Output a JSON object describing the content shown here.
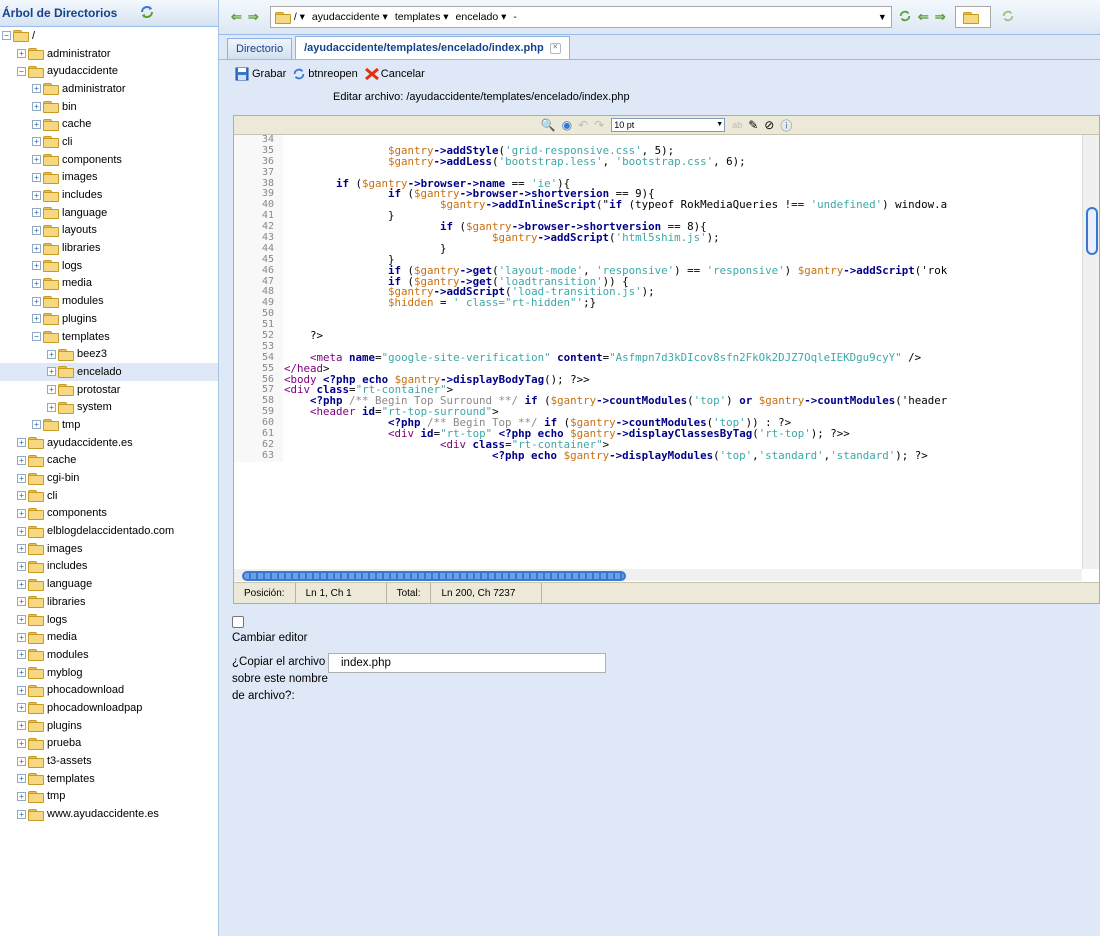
{
  "sidebar": {
    "title": "Árbol de Directorios",
    "tree": [
      {
        "label": "/",
        "level": 0,
        "expanded": true
      },
      {
        "label": "administrator",
        "level": 1,
        "expanded": false
      },
      {
        "label": "ayudaccidente",
        "level": 1,
        "expanded": true
      },
      {
        "label": "administrator",
        "level": 2,
        "expanded": false
      },
      {
        "label": "bin",
        "level": 2,
        "expanded": false
      },
      {
        "label": "cache",
        "level": 2,
        "expanded": false
      },
      {
        "label": "cli",
        "level": 2,
        "expanded": false
      },
      {
        "label": "components",
        "level": 2,
        "expanded": false
      },
      {
        "label": "images",
        "level": 2,
        "expanded": false
      },
      {
        "label": "includes",
        "level": 2,
        "expanded": false
      },
      {
        "label": "language",
        "level": 2,
        "expanded": false
      },
      {
        "label": "layouts",
        "level": 2,
        "expanded": false
      },
      {
        "label": "libraries",
        "level": 2,
        "expanded": false
      },
      {
        "label": "logs",
        "level": 2,
        "expanded": false
      },
      {
        "label": "media",
        "level": 2,
        "expanded": false
      },
      {
        "label": "modules",
        "level": 2,
        "expanded": false
      },
      {
        "label": "plugins",
        "level": 2,
        "expanded": false
      },
      {
        "label": "templates",
        "level": 2,
        "expanded": true
      },
      {
        "label": "beez3",
        "level": 3,
        "expanded": false
      },
      {
        "label": "encelado",
        "level": 3,
        "expanded": false,
        "selected": true
      },
      {
        "label": "protostar",
        "level": 3,
        "expanded": false
      },
      {
        "label": "system",
        "level": 3,
        "expanded": false
      },
      {
        "label": "tmp",
        "level": 2,
        "expanded": false
      },
      {
        "label": "ayudaccidente.es",
        "level": 1,
        "expanded": false
      },
      {
        "label": "cache",
        "level": 1,
        "expanded": false
      },
      {
        "label": "cgi-bin",
        "level": 1,
        "expanded": false
      },
      {
        "label": "cli",
        "level": 1,
        "expanded": false
      },
      {
        "label": "components",
        "level": 1,
        "expanded": false
      },
      {
        "label": "elblogdelaccidentado.com",
        "level": 1,
        "expanded": false
      },
      {
        "label": "images",
        "level": 1,
        "expanded": false
      },
      {
        "label": "includes",
        "level": 1,
        "expanded": false
      },
      {
        "label": "language",
        "level": 1,
        "expanded": false
      },
      {
        "label": "libraries",
        "level": 1,
        "expanded": false
      },
      {
        "label": "logs",
        "level": 1,
        "expanded": false
      },
      {
        "label": "media",
        "level": 1,
        "expanded": false
      },
      {
        "label": "modules",
        "level": 1,
        "expanded": false
      },
      {
        "label": "myblog",
        "level": 1,
        "expanded": false
      },
      {
        "label": "phocadownload",
        "level": 1,
        "expanded": false
      },
      {
        "label": "phocadownloadpap",
        "level": 1,
        "expanded": false
      },
      {
        "label": "plugins",
        "level": 1,
        "expanded": false
      },
      {
        "label": "prueba",
        "level": 1,
        "expanded": false
      },
      {
        "label": "t3-assets",
        "level": 1,
        "expanded": false
      },
      {
        "label": "templates",
        "level": 1,
        "expanded": false
      },
      {
        "label": "tmp",
        "level": 1,
        "expanded": false
      },
      {
        "label": "www.ayudaccidente.es",
        "level": 1,
        "expanded": false
      }
    ]
  },
  "toolbar": {
    "path_segments": [
      "/",
      "ayudaccidente",
      "templates",
      "encelado",
      "-"
    ]
  },
  "tabs": [
    {
      "label": "Directorio",
      "active": false
    },
    {
      "label": "/ayudaccidente/templates/encelado/index.php",
      "active": true
    }
  ],
  "actions": {
    "save": "Grabar",
    "reopen": "btnreopen",
    "cancel": "Cancelar"
  },
  "edit_label": "Editar archivo: /ayudaccidente/templates/encelado/index.php",
  "editor": {
    "font_size": "10 pt",
    "code_lines": [
      {
        "n": "34",
        "h": ""
      },
      {
        "n": "35",
        "h": "                $gantry->addStyle('grid-responsive.css', 5);"
      },
      {
        "n": "36",
        "h": "                $gantry->addLess('bootstrap.less', 'bootstrap.css', 6);"
      },
      {
        "n": "37",
        "h": ""
      },
      {
        "n": "38",
        "h": "        if ($gantry->browser->name == 'ie'){"
      },
      {
        "n": "39",
        "h": "                if ($gantry->browser->shortversion == 9){"
      },
      {
        "n": "40",
        "h": "                        $gantry->addInlineScript(\"if (typeof RokMediaQueries !== 'undefined') window.a"
      },
      {
        "n": "41",
        "h": "                }"
      },
      {
        "n": "42",
        "h": "                        if ($gantry->browser->shortversion == 8){"
      },
      {
        "n": "43",
        "h": "                                $gantry->addScript('html5shim.js');"
      },
      {
        "n": "44",
        "h": "                        }"
      },
      {
        "n": "45",
        "h": "                }"
      },
      {
        "n": "46",
        "h": "                if ($gantry->get('layout-mode', 'responsive') == 'responsive') $gantry->addScript('rok"
      },
      {
        "n": "47",
        "h": "                if ($gantry->get('loadtransition')) {"
      },
      {
        "n": "48",
        "h": "                $gantry->addScript('load-transition.js');"
      },
      {
        "n": "49",
        "h": "                $hidden = ' class=\"rt-hidden\"';}"
      },
      {
        "n": "50",
        "h": ""
      },
      {
        "n": "51",
        "h": ""
      },
      {
        "n": "52",
        "h": "    ?>"
      },
      {
        "n": "53",
        "h": ""
      },
      {
        "n": "54",
        "h": "    <meta name=\"google-site-verification\" content=\"Asfmpn7d3kDIcov8sfn2FkOk2DJZ7OqleIEKDgu9cyY\" />"
      },
      {
        "n": "55",
        "h": "</head>"
      },
      {
        "n": "56",
        "h": "<body <?php echo $gantry->displayBodyTag(); ?>>"
      },
      {
        "n": "57",
        "h": "<div class=\"rt-container\">"
      },
      {
        "n": "58",
        "h": "    <?php /** Begin Top Surround **/ if ($gantry->countModules('top') or $gantry->countModules('header"
      },
      {
        "n": "59",
        "h": "    <header id=\"rt-top-surround\">"
      },
      {
        "n": "60",
        "h": "                <?php /** Begin Top **/ if ($gantry->countModules('top')) : ?>"
      },
      {
        "n": "61",
        "h": "                <div id=\"rt-top\" <?php echo $gantry->displayClassesByTag('rt-top'); ?>>"
      },
      {
        "n": "62",
        "h": "                        <div class=\"rt-container\">"
      },
      {
        "n": "63",
        "h": "                                <?php echo $gantry->displayModules('top','standard','standard'); ?>"
      }
    ]
  },
  "status": {
    "pos_label": "Posición:",
    "pos_value": "Ln 1, Ch 1",
    "total_label": "Total:",
    "total_value": "Ln 200, Ch 7237"
  },
  "change_editor": "Cambiar editor",
  "copy_question": "¿Copiar el archivo sobre este nombre de archivo?:",
  "copy_filename": "index.php"
}
